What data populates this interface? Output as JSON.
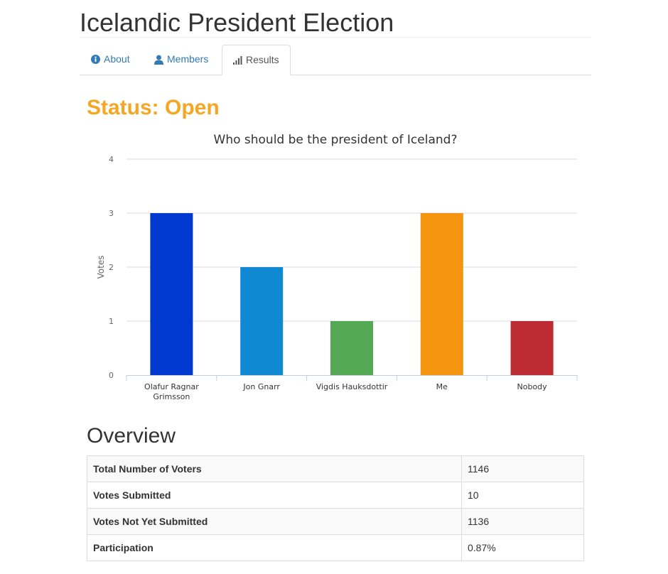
{
  "header": {
    "title": "Icelandic President Election"
  },
  "tabs": [
    {
      "label": "About",
      "icon": "info-circle-icon",
      "active": false
    },
    {
      "label": "Members",
      "icon": "user-icon",
      "active": false
    },
    {
      "label": "Results",
      "icon": "signal-bars-icon",
      "active": true
    }
  ],
  "status": {
    "text": "Status: Open",
    "color": "#f5a623"
  },
  "chart_data": {
    "type": "bar",
    "title": "Who should be the president of Iceland?",
    "xlabel": "",
    "ylabel": "Votes",
    "categories": [
      "Olafur Ragnar Grimsson",
      "Jon Gnarr",
      "Vigdis Hauksdottir",
      "Me",
      "Nobody"
    ],
    "category_lines": [
      [
        "Olafur Ragnar",
        "Grimsson"
      ],
      [
        "Jon Gnarr"
      ],
      [
        "Vigdis Hauksdottir"
      ],
      [
        "Me"
      ],
      [
        "Nobody"
      ]
    ],
    "values": [
      3,
      2,
      1,
      3,
      1
    ],
    "colors": [
      "#0039cf",
      "#1188d2",
      "#55a854",
      "#f5940f",
      "#bc2b32"
    ],
    "ylim": [
      0,
      4
    ],
    "yticks": [
      "0",
      "1",
      "2",
      "3",
      "4"
    ],
    "grid": true,
    "legend": "none"
  },
  "overview": {
    "title": "Overview",
    "rows": [
      {
        "label": "Total Number of Voters",
        "value": "1146"
      },
      {
        "label": "Votes Submitted",
        "value": "10"
      },
      {
        "label": "Votes Not Yet Submitted",
        "value": "1136"
      },
      {
        "label": "Participation",
        "value": "0.87%"
      }
    ]
  },
  "colors": {
    "link": "#337ab7",
    "status": "#f5a623"
  }
}
